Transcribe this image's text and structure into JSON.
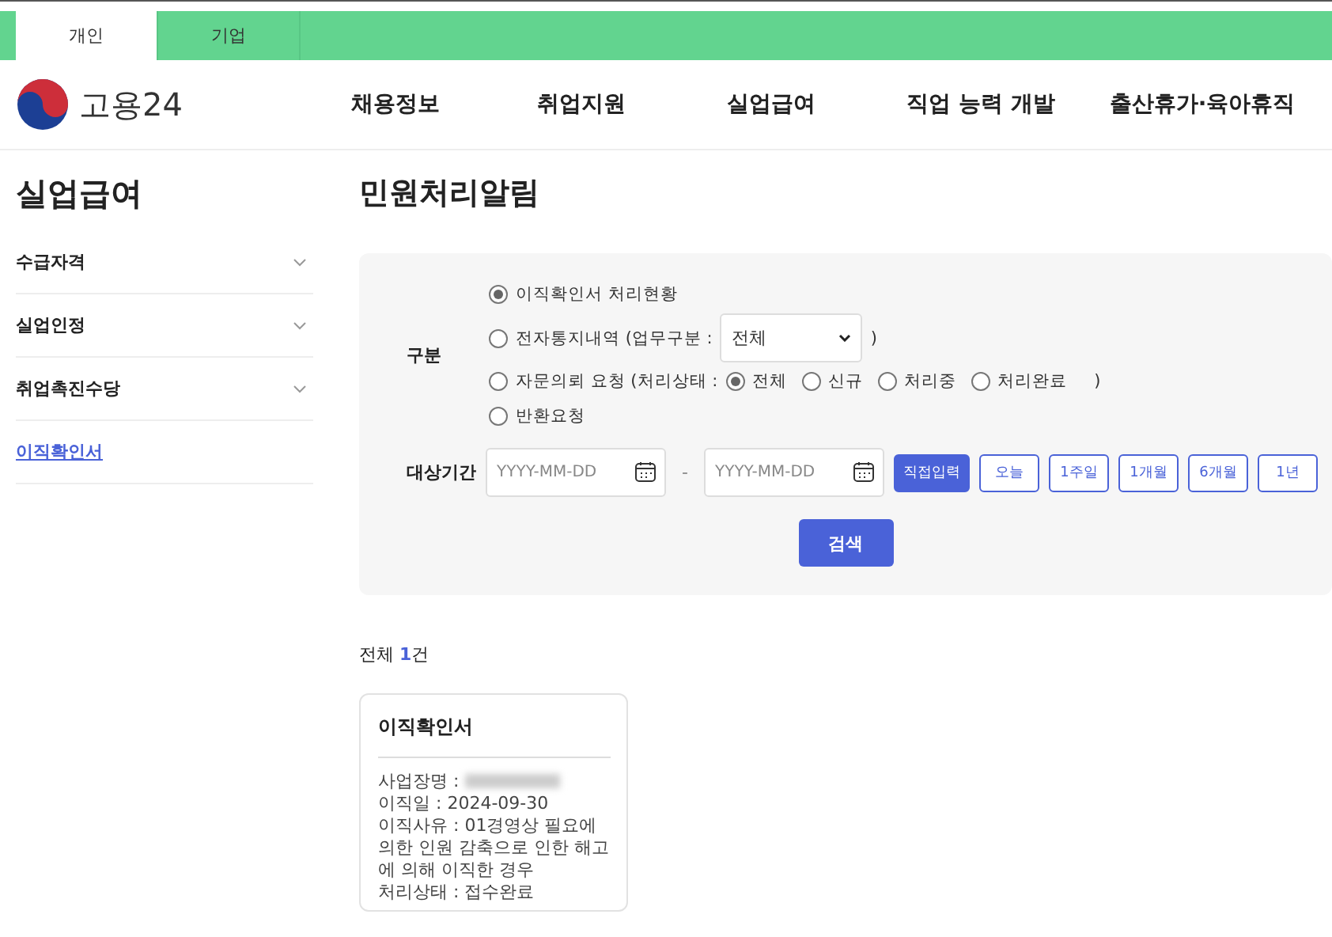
{
  "top_tabs": [
    {
      "label": "개인",
      "selected": true
    },
    {
      "label": "기업",
      "selected": false
    }
  ],
  "logo": {
    "text": "고용24"
  },
  "nav": [
    "채용정보",
    "취업지원",
    "실업급여",
    "직업 능력 개발",
    "출산휴가·육아휴직"
  ],
  "sidebar": {
    "title": "실업급여",
    "items": [
      {
        "label": "수급자격",
        "expanded": false,
        "selected": false
      },
      {
        "label": "실업인정",
        "expanded": false,
        "selected": false
      },
      {
        "label": "취업촉진수당",
        "expanded": false,
        "selected": false
      },
      {
        "label": "이직확인서",
        "selected": true
      }
    ]
  },
  "page_title": "민원처리알림",
  "filter": {
    "category_label": "구분",
    "options": [
      {
        "label": "이직확인서 처리현황",
        "selected": true,
        "kind": "plain"
      },
      {
        "label": "전자통지내역 (업무구분 :",
        "selected": false,
        "kind": "select",
        "select_value": "전체",
        "close": ")"
      },
      {
        "label": "자문의뢰 요청 (처리상태 :",
        "selected": false,
        "kind": "radios",
        "close": ")",
        "sub_options": [
          {
            "label": "전체",
            "selected": true
          },
          {
            "label": "신규",
            "selected": false
          },
          {
            "label": "처리중",
            "selected": false
          },
          {
            "label": "처리완료",
            "selected": false
          }
        ]
      },
      {
        "label": "반환요청",
        "selected": false,
        "kind": "plain"
      }
    ],
    "period_label": "대상기간",
    "date_from": {
      "placeholder": "YYYY-MM-DD"
    },
    "separator": "-",
    "date_to": {
      "placeholder": "YYYY-MM-DD"
    },
    "period_buttons": [
      {
        "label": "직접입력",
        "selected": true
      },
      {
        "label": "오늘",
        "selected": false
      },
      {
        "label": "1주일",
        "selected": false
      },
      {
        "label": "1개월",
        "selected": false
      },
      {
        "label": "6개월",
        "selected": false
      },
      {
        "label": "1년",
        "selected": false
      }
    ],
    "search_button": "검색"
  },
  "result_count": {
    "prefix": "전체",
    "count": "1",
    "suffix": "건"
  },
  "cards": [
    {
      "title": "이직확인서",
      "business_label": "사업장명 :",
      "lines": [
        "이직일 : 2024-09-30",
        "이직사유 : 01경영상 필요에 의한 인원 감축으로 인한 해고에 의해 이직한 경우",
        "처리상태 : 접수완료"
      ]
    }
  ]
}
